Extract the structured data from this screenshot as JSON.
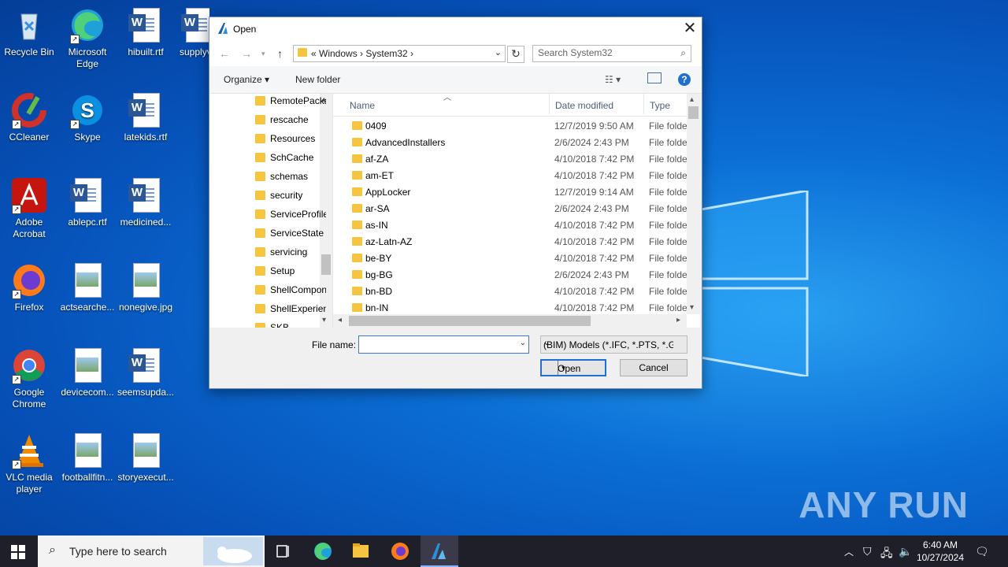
{
  "desktop": {
    "icons": [
      {
        "label": "Recycle Bin"
      },
      {
        "label": "Microsoft Edge"
      },
      {
        "label": "hibuilt.rtf"
      },
      {
        "label": "supplyv..."
      },
      {
        "label": "CCleaner"
      },
      {
        "label": "Skype"
      },
      {
        "label": "latekids.rtf"
      },
      {
        "label": "Adobe Acrobat"
      },
      {
        "label": "ablepc.rtf"
      },
      {
        "label": "medicined..."
      },
      {
        "label": "Firefox"
      },
      {
        "label": "actsearche..."
      },
      {
        "label": "nonegive.jpg"
      },
      {
        "label": "Google Chrome"
      },
      {
        "label": "devicecom..."
      },
      {
        "label": "seemsupda..."
      },
      {
        "label": "VLC media player"
      },
      {
        "label": "footballfitn..."
      },
      {
        "label": "storyexecut..."
      }
    ],
    "watermark": "ANY RUN"
  },
  "dialog": {
    "title": "Open",
    "close": "✕",
    "address": {
      "crumbs": "«  Windows  ›  System32  ›"
    },
    "search": {
      "placeholder": "Search System32"
    },
    "toolbar": {
      "organize": "Organize ▾",
      "new_folder": "New folder",
      "help": "?"
    },
    "tree": [
      "RemotePackages",
      "rescache",
      "Resources",
      "SchCache",
      "schemas",
      "security",
      "ServiceProfiles",
      "ServiceState",
      "servicing",
      "Setup",
      "ShellComponents",
      "ShellExperiences",
      "SKB"
    ],
    "columns": {
      "name": "Name",
      "date": "Date modified",
      "type": "Type"
    },
    "files": [
      {
        "name": "0409",
        "date": "12/7/2019 9:50 AM",
        "type": "File folder"
      },
      {
        "name": "AdvancedInstallers",
        "date": "2/6/2024 2:43 PM",
        "type": "File folder"
      },
      {
        "name": "af-ZA",
        "date": "4/10/2018 7:42 PM",
        "type": "File folder"
      },
      {
        "name": "am-ET",
        "date": "4/10/2018 7:42 PM",
        "type": "File folder"
      },
      {
        "name": "AppLocker",
        "date": "12/7/2019 9:14 AM",
        "type": "File folder"
      },
      {
        "name": "ar-SA",
        "date": "2/6/2024 2:43 PM",
        "type": "File folder"
      },
      {
        "name": "as-IN",
        "date": "4/10/2018 7:42 PM",
        "type": "File folder"
      },
      {
        "name": "az-Latn-AZ",
        "date": "4/10/2018 7:42 PM",
        "type": "File folder"
      },
      {
        "name": "be-BY",
        "date": "4/10/2018 7:42 PM",
        "type": "File folder"
      },
      {
        "name": "bg-BG",
        "date": "2/6/2024 2:43 PM",
        "type": "File folder"
      },
      {
        "name": "bn-BD",
        "date": "4/10/2018 7:42 PM",
        "type": "File folder"
      },
      {
        "name": "bn-IN",
        "date": "4/10/2018 7:42 PM",
        "type": "File folder"
      }
    ],
    "filename_label": "File name:",
    "filename_value": "",
    "filetype": "(BIM) Models (*.IFC, *.PTS, *.GM",
    "open_label": "Open",
    "cancel_label": "Cancel"
  },
  "taskbar": {
    "search_placeholder": "Type here to search",
    "time": "6:40 AM",
    "date": "10/27/2024"
  },
  "colors": {
    "accent": "#1e6fd0",
    "folder": "#f5c542",
    "taskbar": "#1f1f2a"
  }
}
